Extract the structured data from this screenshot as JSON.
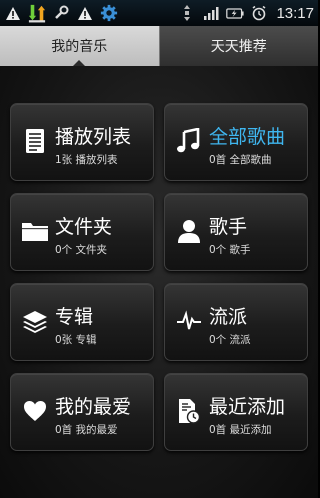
{
  "status_bar": {
    "time": "13:17",
    "icons": [
      "warning-icon",
      "usb-transfer-icon",
      "wrench-icon",
      "warning-icon",
      "gear-icon",
      "data-arrows-icon",
      "signal-icon",
      "battery-icon",
      "alarm-icon"
    ]
  },
  "tabs": [
    {
      "label": "我的音乐",
      "active": true
    },
    {
      "label": "天天推荐",
      "active": false
    }
  ],
  "tiles": [
    {
      "title": "播放列表",
      "subtitle": "1张 播放列表",
      "icon": "playlist-icon",
      "selected": false
    },
    {
      "title": "全部歌曲",
      "subtitle": "0首 全部歌曲",
      "icon": "music-note-icon",
      "selected": true
    },
    {
      "title": "文件夹",
      "subtitle": "0个 文件夹",
      "icon": "folder-icon",
      "selected": false
    },
    {
      "title": "歌手",
      "subtitle": "0个 歌手",
      "icon": "artist-icon",
      "selected": false
    },
    {
      "title": "专辑",
      "subtitle": "0张 专辑",
      "icon": "album-layers-icon",
      "selected": false
    },
    {
      "title": "流派",
      "subtitle": "0个 流派",
      "icon": "genre-wave-icon",
      "selected": false
    },
    {
      "title": "我的最爱",
      "subtitle": "0首 我的最爱",
      "icon": "heart-icon",
      "selected": false
    },
    {
      "title": "最近添加",
      "subtitle": "0首 最近添加",
      "icon": "recent-added-icon",
      "selected": false
    }
  ],
  "colors": {
    "accent": "#3fb6ef"
  }
}
